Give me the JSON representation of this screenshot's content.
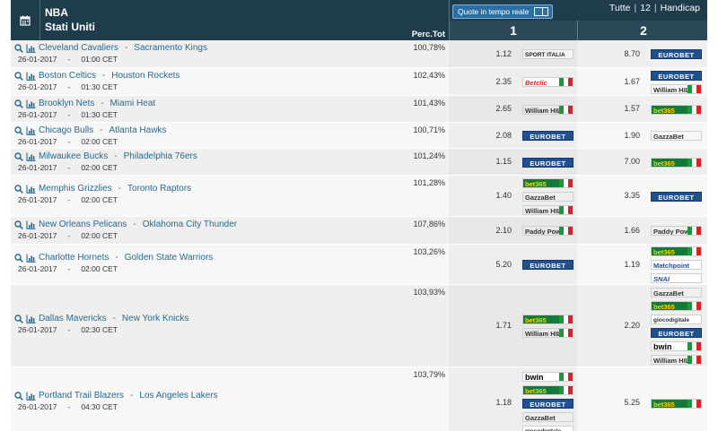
{
  "header": {
    "league": "NBA",
    "country": "Stati Uniti",
    "perc_label": "Perc.Tot",
    "live_label": "Quote in tempo reale",
    "tabs": [
      "Tutte",
      "12",
      "Handicap"
    ],
    "col1": "1",
    "col2": "2",
    "icons": {
      "calendar": "calendar-icon"
    }
  },
  "colors": {
    "header_bg": "#1f3c4b",
    "link": "#2a6a8c",
    "live_button": "#2b6fa3"
  },
  "matches": [
    {
      "home": "Cleveland Cavaliers",
      "away": "Sacramento Kings",
      "date": "26-01-2017",
      "time": "01:00 CET",
      "pct": "100,78%",
      "odd1": "1.12",
      "odd2": "8.70",
      "books1": [
        "sportitalia"
      ],
      "books2": [
        "eurobet"
      ]
    },
    {
      "home": "Boston Celtics",
      "away": "Houston Rockets",
      "date": "26-01-2017",
      "time": "01:30 CET",
      "pct": "102,43%",
      "odd1": "2.35",
      "odd2": "1.67",
      "books1": [
        "betclic"
      ],
      "books2": [
        "eurobet",
        "williamhill"
      ]
    },
    {
      "home": "Brooklyn Nets",
      "away": "Miami Heat",
      "date": "26-01-2017",
      "time": "01:30 CET",
      "pct": "101,43%",
      "odd1": "2.65",
      "odd2": "1.57",
      "books1": [
        "williamhill"
      ],
      "books2": [
        "bet365"
      ]
    },
    {
      "home": "Chicago Bulls",
      "away": "Atlanta Hawks",
      "date": "26-01-2017",
      "time": "02:00 CET",
      "pct": "100,71%",
      "odd1": "2.08",
      "odd2": "1.90",
      "books1": [
        "eurobet"
      ],
      "books2": [
        "gazzabet"
      ]
    },
    {
      "home": "Milwaukee Bucks",
      "away": "Philadelphia 76ers",
      "date": "26-01-2017",
      "time": "02:00 CET",
      "pct": "101,24%",
      "odd1": "1.15",
      "odd2": "7.00",
      "books1": [
        "eurobet"
      ],
      "books2": [
        "bet365"
      ]
    },
    {
      "home": "Memphis Grizzlies",
      "away": "Toronto Raptors",
      "date": "26-01-2017",
      "time": "02:00 CET",
      "pct": "101,28%",
      "odd1": "1.40",
      "odd2": "3.35",
      "books1": [
        "bet365",
        "gazzabet",
        "williamhill"
      ],
      "books2": [
        "eurobet"
      ]
    },
    {
      "home": "New Orleans Pelicans",
      "away": "Oklahoma City Thunder",
      "date": "26-01-2017",
      "time": "02:00 CET",
      "pct": "107,86%",
      "odd1": "2.10",
      "odd2": "1.66",
      "books1": [
        "paddypower"
      ],
      "books2": [
        "paddypower"
      ]
    },
    {
      "home": "Charlotte Hornets",
      "away": "Golden State Warriors",
      "date": "26-01-2017",
      "time": "02:00 CET",
      "pct": "103,26%",
      "odd1": "5.20",
      "odd2": "1.19",
      "books1": [
        "eurobet"
      ],
      "books2": [
        "bet365",
        "matchpoint",
        "snai"
      ]
    },
    {
      "home": "Dallas Mavericks",
      "away": "New York Knicks",
      "date": "26-01-2017",
      "time": "02:30 CET",
      "pct": "103,93%",
      "odd1": "1.71",
      "odd2": "2.20",
      "books1": [
        "bet365",
        "williamhill"
      ],
      "books2": [
        "gazzabet",
        "bet365",
        "giocodigitale",
        "eurobet",
        "bwin",
        "williamhill"
      ]
    },
    {
      "home": "Portland Trail Blazers",
      "away": "Los Angeles Lakers",
      "date": "26-01-2017",
      "time": "04:30 CET",
      "pct": "103,79%",
      "odd1": "1.18",
      "odd2": "5.25",
      "books1": [
        "bwin",
        "bet365",
        "eurobet",
        "gazzabet",
        "giocodigitale"
      ],
      "books2": [
        "bet365"
      ]
    }
  ],
  "bookmakers": {
    "eurobet": {
      "label": "EUROBET",
      "flag": false
    },
    "bet365": {
      "label": "bet365",
      "flag": true
    },
    "williamhill": {
      "label": "William HILL",
      "flag": true
    },
    "gazzabet": {
      "label": "GazzaBet",
      "flag": false
    },
    "paddypower": {
      "label": "Paddy Power",
      "flag": true
    },
    "sportitalia": {
      "label": "SPORT ITALIA",
      "flag": false
    },
    "betclic": {
      "label": "Betclic",
      "flag": true
    },
    "matchpoint": {
      "label": "Matchpoint",
      "flag": false
    },
    "snai": {
      "label": "SNAI",
      "flag": false
    },
    "bwin": {
      "label": "bwin",
      "flag": true
    },
    "giocodigitale": {
      "label": "giocodigitale",
      "flag": false
    }
  }
}
